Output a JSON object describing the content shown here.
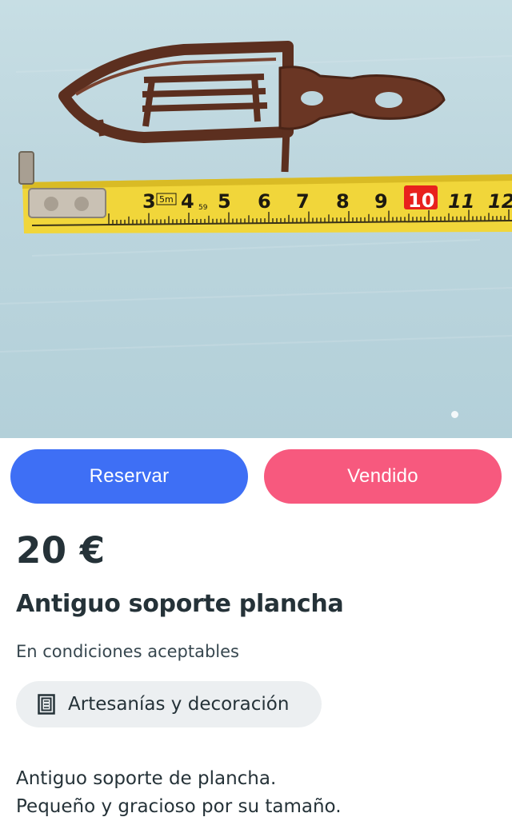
{
  "photo": {
    "alt": "",
    "tape_numbers": [
      "3",
      "4",
      "5",
      "6",
      "7",
      "8",
      "9",
      "10",
      "11",
      "12"
    ],
    "tape_small_marks": [
      "5m",
      "59"
    ]
  },
  "actions": {
    "reserve_label": "Reservar",
    "sold_label": "Vendido"
  },
  "product": {
    "price": "20 €",
    "title": "Antiguo soporte plancha",
    "condition": "En condiciones aceptables",
    "category": {
      "label": "Artesanías y decoración",
      "icon": "artwork-frame-icon"
    },
    "description_lines": [
      "Antiguo soporte de plancha.",
      "Pequeño y gracioso por su tamaño."
    ]
  },
  "colors": {
    "reserve": "#3e6ff5",
    "sold": "#f7597e",
    "text": "#253238",
    "chip_bg": "#eceff1"
  }
}
